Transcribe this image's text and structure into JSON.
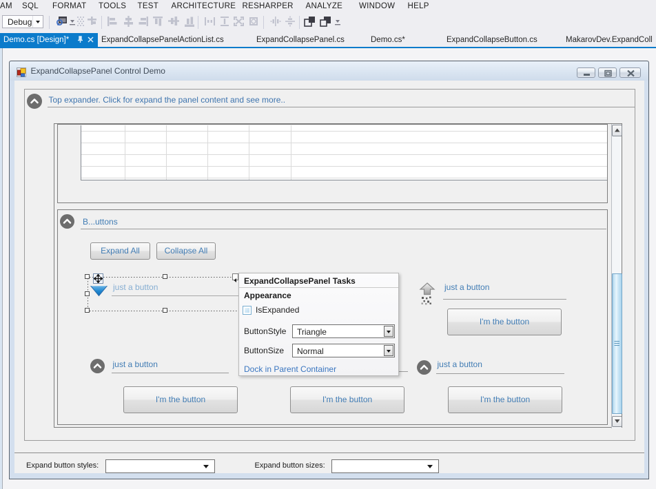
{
  "menu": {
    "items": [
      {
        "label": "AM"
      },
      {
        "label": "SQL"
      },
      {
        "label": "FORMAT"
      },
      {
        "label": "TOOLS"
      },
      {
        "label": "TEST"
      },
      {
        "label": "ARCHITECTURE"
      },
      {
        "label": "RESHARPER"
      },
      {
        "label": "ANALYZE"
      },
      {
        "label": "WINDOW"
      },
      {
        "label": "HELP"
      }
    ]
  },
  "toolbar": {
    "debug_label": "Debug",
    "icons": [
      "preview-dialog-icon",
      "toolbar-options-icon",
      "snap-to-grid-icon",
      "align-to-grid-icon",
      "align-lefts-icon",
      "align-centers-icon",
      "align-rights-icon",
      "align-tops-icon",
      "align-middles-icon",
      "align-bottoms-icon",
      "make-same-width-icon",
      "make-same-height-icon",
      "make-same-size-icon",
      "size-to-grid-icon",
      "horizontal-spacing-icon",
      "vertical-spacing-icon",
      "bring-to-front-icon",
      "send-to-back-icon",
      "toolbar-overflow-icon"
    ]
  },
  "tabs": {
    "active": {
      "label": "Demo.cs [Design]*"
    },
    "inactive": [
      {
        "label": "ExpandCollapsePanelActionList.cs"
      },
      {
        "label": "ExpandCollapsePanel.cs"
      },
      {
        "label": "Demo.cs*"
      },
      {
        "label": "ExpandCollapseButton.cs"
      },
      {
        "label": "MakarovDev.ExpandColl"
      }
    ]
  },
  "form": {
    "title": "ExpandCollapsePanel Control Demo",
    "window_buttons": [
      "minimize-button",
      "maximize-button",
      "close-button"
    ]
  },
  "designer": {
    "top_expander": {
      "header": "Top expander. Click for expand the panel content and see more.."
    },
    "buttons_panel": {
      "header": "B...uttons",
      "expand_all": "Expand All",
      "collapse_all": "Collapse All"
    },
    "selected_panel": {
      "label": "just a button"
    },
    "right_panel": {
      "label": "just a button",
      "button": "I'm the button"
    },
    "bottom_left_panel": {
      "label": "just a button",
      "button": "I'm the button"
    },
    "bottom_middle_panel": {
      "button": "I'm the button"
    },
    "bottom_right_panel": {
      "label": "just a button",
      "button": "I'm the button"
    }
  },
  "smart_tag": {
    "title": "ExpandCollapsePanel Tasks",
    "section": "Appearance",
    "checkbox_label": "IsExpanded",
    "checkbox_checked": false,
    "rows": [
      {
        "label": "ButtonStyle",
        "value": "Triangle"
      },
      {
        "label": "ButtonSize",
        "value": "Normal"
      }
    ],
    "link": "Dock in Parent Container"
  },
  "bottom_bar": {
    "styles_label": "Expand button styles:",
    "sizes_label": "Expand button sizes:",
    "styles_value": "",
    "sizes_value": ""
  },
  "colors": {
    "accent_blue": "#0b7bcb",
    "designer_text_blue": "#417cb4",
    "selected_text_blue": "#86aed2",
    "link_blue": "#3a76c0",
    "expander_circle_gray": "#6d6d6d",
    "triangle_blue": "#1b82cd",
    "form_bg": "#f0f0f0",
    "vs_chrome_bg": "#eeeef2"
  }
}
